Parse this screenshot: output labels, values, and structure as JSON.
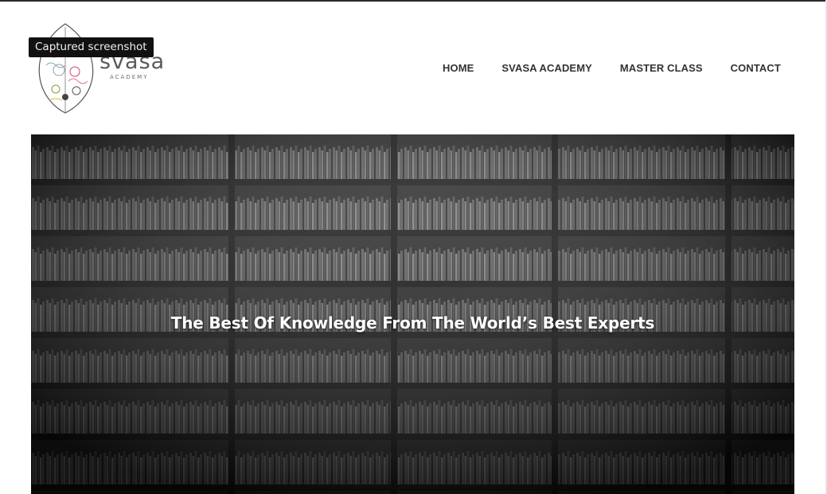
{
  "tooltip": "Captured screenshot",
  "logo": {
    "name": "svasa",
    "tagline": "ACADEMY"
  },
  "nav": [
    {
      "label": "HOME"
    },
    {
      "label": "SVASA ACADEMY"
    },
    {
      "label": "MASTER CLASS"
    },
    {
      "label": "CONTACT"
    }
  ],
  "hero": {
    "title": "The Best Of Knowledge From The World’s Best Experts"
  },
  "icons": {
    "logo": "leaf-mandala-logo"
  }
}
